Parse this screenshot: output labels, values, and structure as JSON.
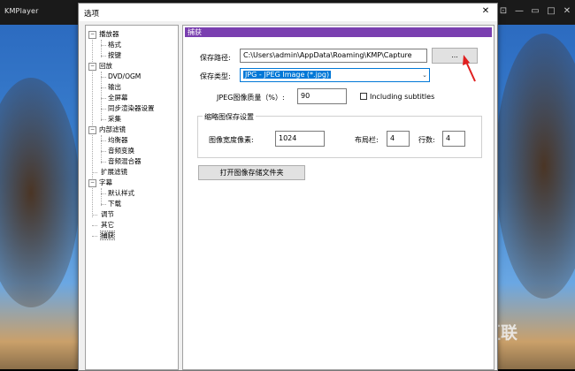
{
  "player": {
    "title": "KMPlayer",
    "controls": {
      "pin": "⊡",
      "minimize": "—",
      "maximize": "□",
      "mini": "▭",
      "close": "✕"
    },
    "watermark": "的互联"
  },
  "dialog": {
    "title": "选项",
    "close": "✕"
  },
  "tree": {
    "items": [
      {
        "label": "播放器",
        "level": 0,
        "expander": "−"
      },
      {
        "label": "格式",
        "level": 1
      },
      {
        "label": "按键",
        "level": 1
      },
      {
        "label": "回放",
        "level": 0,
        "expander": "−"
      },
      {
        "label": "DVD/OGM",
        "level": 1
      },
      {
        "label": "输出",
        "level": 1
      },
      {
        "label": "全屏幕",
        "level": 1
      },
      {
        "label": "同步渲染器设置",
        "level": 1
      },
      {
        "label": "采集",
        "level": 1
      },
      {
        "label": "内部滤镜",
        "level": 0,
        "expander": "−"
      },
      {
        "label": "均衡器",
        "level": 1
      },
      {
        "label": "音频变换",
        "level": 1
      },
      {
        "label": "音频混合器",
        "level": 1
      },
      {
        "label": "扩展滤镜",
        "level": 0
      },
      {
        "label": "字幕",
        "level": 0,
        "expander": "−"
      },
      {
        "label": "默认样式",
        "level": 1
      },
      {
        "label": "下载",
        "level": 1
      },
      {
        "label": "调节",
        "level": 0
      },
      {
        "label": "其它",
        "level": 0
      },
      {
        "label": "捕获",
        "level": 0,
        "selected": true
      }
    ]
  },
  "panel": {
    "header": "捕获",
    "save_path_label": "保存路径:",
    "save_path_value": "C:\\Users\\admin\\AppData\\Roaming\\KMP\\Capture",
    "browse_label": "...",
    "save_type_label": "保存类型:",
    "save_type_value": "JPG - JPEG Image (*.jpg)",
    "jpeg_quality_label": "JPEG图像质量（%）:",
    "jpeg_quality_value": "90",
    "include_subtitles_label": "Including subtitles",
    "include_subtitles_checked": false,
    "thumb_group_title": "缩略图保存设置",
    "image_width_label": "图像宽度像素:",
    "image_width_value": "1024",
    "layout_label": "布局栏:",
    "layout_value": "4",
    "rows_label": "行数:",
    "rows_value": "4",
    "open_folder_label": "打开图像存储文件夹"
  },
  "colors": {
    "accent": "#7a3fb0",
    "selection": "#0078d7",
    "arrow": "#e02020"
  }
}
